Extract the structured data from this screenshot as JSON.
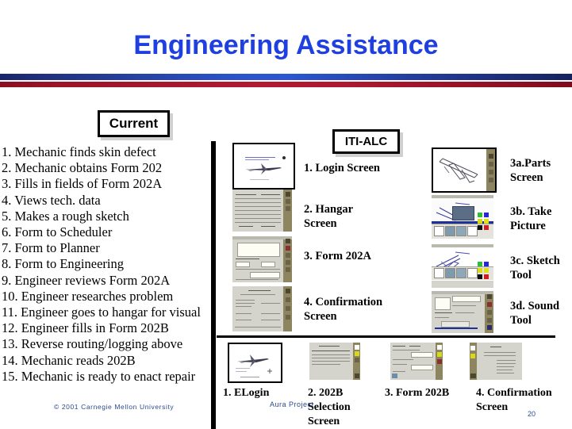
{
  "slide": {
    "title": "Engineering Assistance",
    "page_number": "20",
    "copyright": "© 2001 Carnegie Mellon University",
    "aura_project": "Aura Project"
  },
  "callouts": {
    "current": "Current",
    "iti_alc": "ITI-ALC"
  },
  "current_process": {
    "steps": [
      "1. Mechanic finds skin defect",
      "2. Mechanic obtains Form 202",
      "3. Fills in fields of Form 202A",
      "4. Views tech. data",
      "5. Makes a rough sketch",
      "6. Form to Scheduler",
      "7. Form to Planner",
      "8. Form to Engineering",
      "9. Engineer reviews Form 202A",
      "10. Engineer researches problem",
      "11. Engineer goes to hangar for visual",
      "12. Engineer fills in Form 202B",
      "13. Reverse routing/logging above",
      "14. Mechanic reads 202B",
      "15. Mechanic is ready to enact repair"
    ]
  },
  "middle_column": {
    "screens": [
      {
        "label": "1. Login Screen",
        "thumb": "login-screen-thumbnail"
      },
      {
        "label": "2. Hangar Screen",
        "thumb": "hangar-screen-thumbnail"
      },
      {
        "label": "3. Form 202A",
        "thumb": "form-202a-thumbnail"
      },
      {
        "label": "4. Confirmation Screen",
        "thumb": "confirmation-screen-thumbnail"
      }
    ]
  },
  "right_column": {
    "screens": [
      {
        "label": "3a.Parts Screen",
        "thumb": "parts-screen-thumbnail"
      },
      {
        "label": "3b. Take Picture",
        "thumb": "take-picture-thumbnail"
      },
      {
        "label": "3c. Sketch Tool",
        "thumb": "sketch-tool-thumbnail"
      },
      {
        "label": "3d. Sound Tool",
        "thumb": "sound-tool-thumbnail"
      }
    ]
  },
  "bottom_row": {
    "screens": [
      {
        "label": "1. ELogin",
        "thumb": "elogin-thumbnail"
      },
      {
        "label": "2. 202B Selection Screen",
        "thumb": "202b-selection-thumbnail"
      },
      {
        "label": "3. Form 202B",
        "thumb": "form-202b-thumbnail"
      },
      {
        "label": "4. Confirmation Screen",
        "thumb": "bottom-confirmation-thumbnail"
      }
    ]
  },
  "colors": {
    "title_blue": "#1f3fe0",
    "rule_blue": "#2a53c8",
    "rule_red": "#b01a32",
    "sidebar_olive": "#8d8560",
    "footer_blue": "#2a4a8c"
  }
}
